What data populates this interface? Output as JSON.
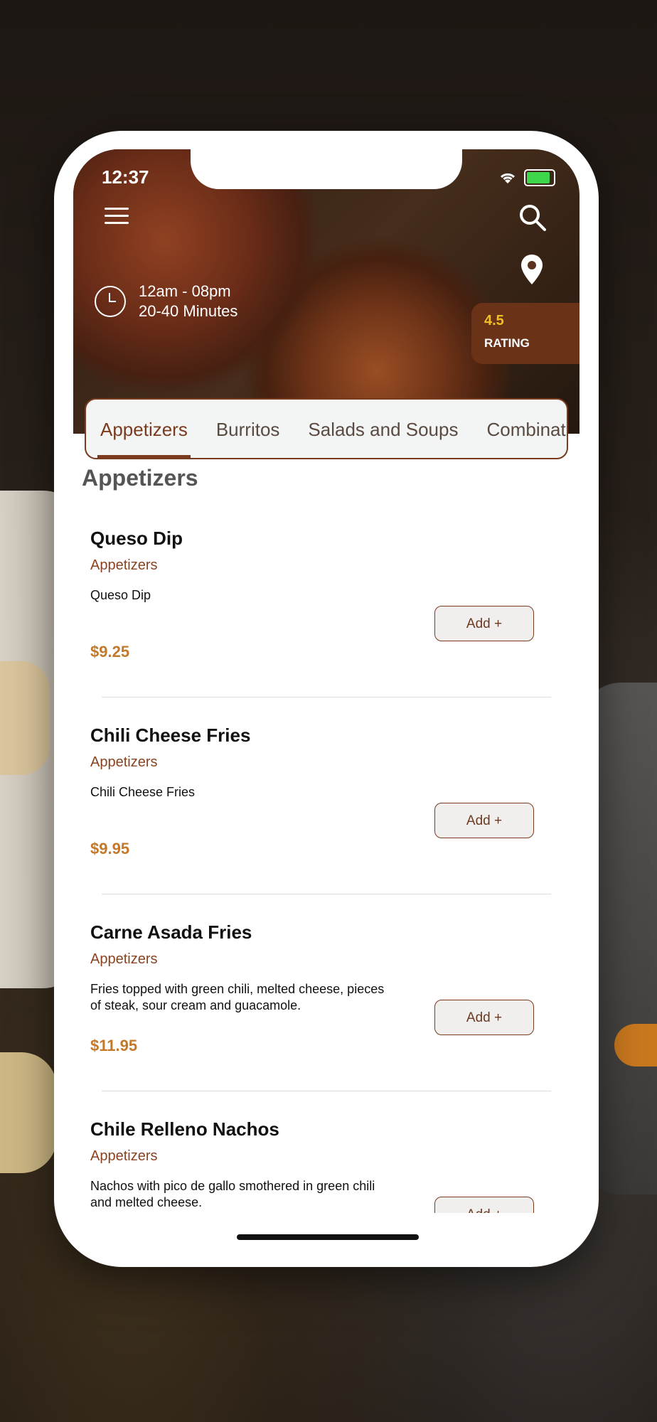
{
  "status": {
    "time": "12:37"
  },
  "store": {
    "hours": "12am - 08pm",
    "prep_time": "20-40 Minutes",
    "rating_value": "4.5",
    "rating_label": "RATING"
  },
  "tabs": [
    {
      "label": "Appetizers"
    },
    {
      "label": "Burritos"
    },
    {
      "label": "Salads and Soups"
    },
    {
      "label": "Combinations"
    }
  ],
  "section_title": "Appetizers",
  "items": [
    {
      "name": "Queso Dip",
      "category": "Appetizers",
      "description": "Queso Dip",
      "price": "$9.25",
      "add_label": "Add +"
    },
    {
      "name": "Chili Cheese Fries",
      "category": "Appetizers",
      "description": "Chili Cheese Fries",
      "price": "$9.95",
      "add_label": "Add +"
    },
    {
      "name": "Carne Asada Fries",
      "category": "Appetizers",
      "description": "Fries topped with green chili, melted cheese, pieces of steak, sour cream and guacamole.",
      "price": "$11.95",
      "add_label": "Add +"
    },
    {
      "name": "Chile Relleno Nachos",
      "category": "Appetizers",
      "description": "Nachos with pico de gallo smothered in green chili and melted cheese.",
      "price": "",
      "add_label": "Add +"
    }
  ],
  "colors": {
    "accent": "#7b3b1e",
    "price": "#c4782a",
    "rating": "#f0c022"
  },
  "icons": [
    "menu-icon",
    "search-icon",
    "location-pin-icon",
    "clock-icon",
    "wifi-icon",
    "battery-icon"
  ]
}
